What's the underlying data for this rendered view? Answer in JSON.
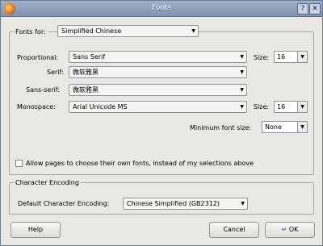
{
  "window": {
    "title": "Fonts"
  },
  "fonts_for": {
    "label": "Fonts for:",
    "value": "Simplified Chinese"
  },
  "proportional": {
    "label": "Proportional:",
    "value": "Sans Serif",
    "size_label": "Size:",
    "size": "16"
  },
  "serif": {
    "label": "Serif:",
    "value": "微软雅黑"
  },
  "sans_serif": {
    "label": "Sans-serif:",
    "value": "微软雅黑"
  },
  "monospace": {
    "label": "Monospace:",
    "value": "Arial Unicode MS",
    "size_label": "Size:",
    "size": "16"
  },
  "minimum_font_size": {
    "label": "Minimum font size:",
    "value": "None"
  },
  "allow_pages": {
    "label": "Allow pages to choose their own fonts, instead of my selections above"
  },
  "encoding": {
    "group_label": "Character Encoding",
    "label": "Default Character Encoding:",
    "value": "Chinese Simplified (GB2312)"
  },
  "buttons": {
    "help": "Help",
    "cancel": "Cancel",
    "ok": "OK"
  }
}
